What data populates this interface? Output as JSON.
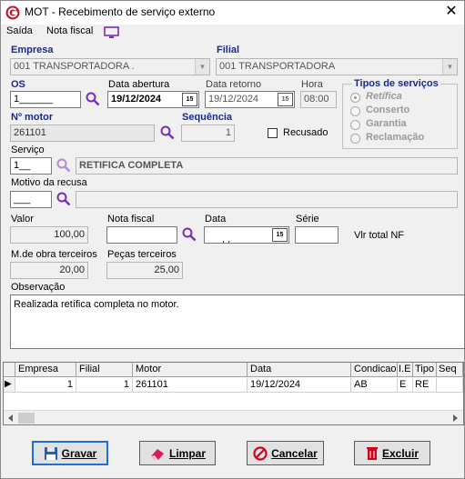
{
  "window": {
    "title": "MOT - Recebimento de serviço externo",
    "app_icon": "g-logo-icon",
    "close_icon": "close-icon"
  },
  "menu": {
    "items": [
      "Saída",
      "Nota fiscal"
    ],
    "monitor_icon": "monitor-icon"
  },
  "form": {
    "empresa": {
      "label": "Empresa",
      "value": "001 TRANSPORTADORA ."
    },
    "filial": {
      "label": "Filial",
      "value": "001 TRANSPORTADORA"
    },
    "os": {
      "label": "OS",
      "value": "1______"
    },
    "data_abertura": {
      "label": "Data abertura",
      "value": "19/12/2024"
    },
    "data_retorno": {
      "label": "Data retorno",
      "value": "19/12/2024"
    },
    "hora": {
      "label": "Hora",
      "value": "08:00"
    },
    "tipos_servicos": {
      "label": "Tipos de serviços",
      "options": [
        "Retífica",
        "Conserto",
        "Garantia",
        "Reclamação"
      ],
      "selected": "Retífica"
    },
    "n_motor": {
      "label": "Nº motor",
      "value": "261101"
    },
    "sequencia": {
      "label": "Sequência",
      "value": "1"
    },
    "recusado": {
      "label": "Recusado",
      "checked": false
    },
    "servico": {
      "label": "Serviço",
      "code": "1__",
      "description": "RETIFICA COMPLETA"
    },
    "motivo_recusa": {
      "label": "Motivo da recusa",
      "code": "___",
      "description": ""
    },
    "valor": {
      "label": "Valor",
      "value": "100,00"
    },
    "nota_fiscal": {
      "label": "Nota fiscal",
      "value": ""
    },
    "data": {
      "label": "Data",
      "value": " / /"
    },
    "serie": {
      "label": "Série",
      "value": ""
    },
    "vlr_total_nf": {
      "label": "Vlr total NF"
    },
    "mao_obra": {
      "label": "M.de obra terceiros",
      "value": "20,00"
    },
    "pecas": {
      "label": "Peças terceiros",
      "value": "25,00"
    },
    "observacao": {
      "label": "Observação",
      "value": "Realizada retífica completa no motor."
    }
  },
  "grid": {
    "columns": [
      "Empresa",
      "Filial",
      "Motor",
      "Data",
      "Condicao",
      "I.E",
      "Tipo",
      "Seq"
    ],
    "rows": [
      [
        "1",
        "1",
        "261101",
        "19/12/2024",
        "AB",
        "E",
        "RE",
        ""
      ]
    ],
    "row_indicator": "▶"
  },
  "buttons": {
    "gravar": {
      "label": "Gravar",
      "icon": "floppy-disk-icon"
    },
    "limpar": {
      "label": "Limpar",
      "icon": "eraser-icon"
    },
    "cancelar": {
      "label": "Cancelar",
      "icon": "cancel-icon"
    },
    "excluir": {
      "label": "Excluir",
      "icon": "trash-icon"
    }
  },
  "colors": {
    "accent_purple": "#7a2bbf",
    "label_blue": "#1a2a8a",
    "logo_red": "#c8102e",
    "focus_blue": "#1e6fd0"
  },
  "calendar_glyph": "15"
}
